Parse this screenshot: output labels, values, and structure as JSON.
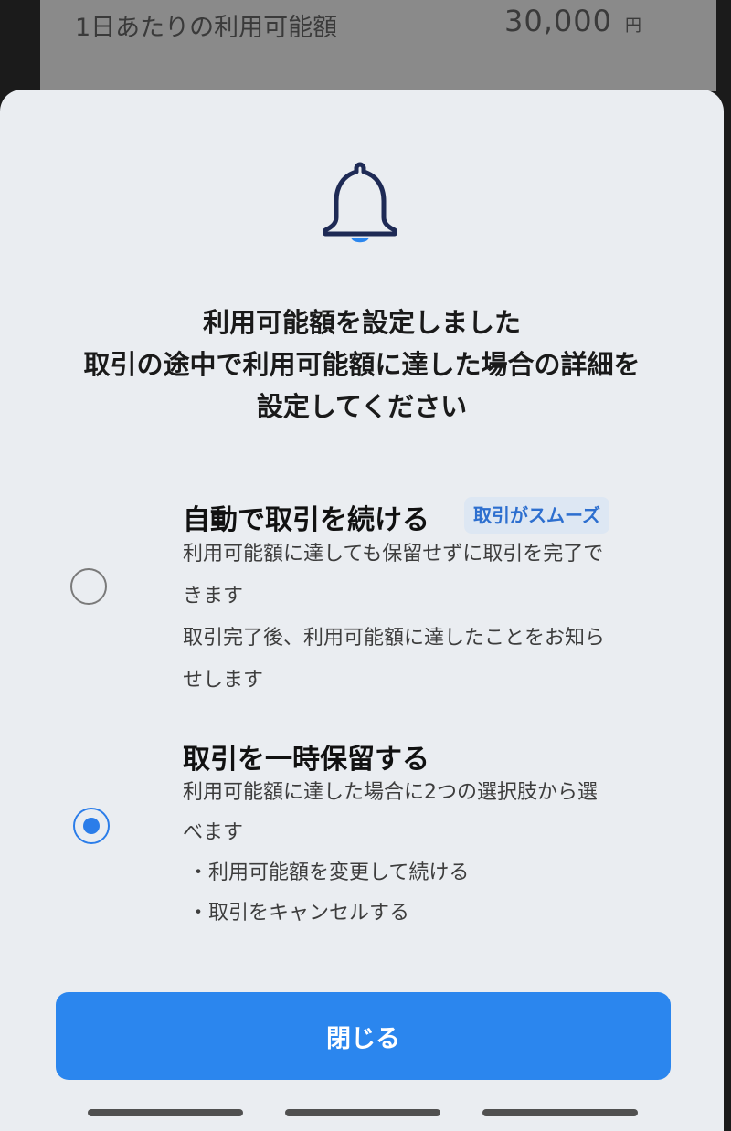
{
  "background": {
    "label": "1日あたりの利用可能額",
    "amount": "30,000",
    "unit": "円"
  },
  "sheet": {
    "icon": "bell-icon",
    "heading_lines": [
      "利用可能額を設定しました",
      "取引の途中で利用可能額に達した場合の詳細を",
      "設定してください"
    ],
    "options": [
      {
        "title": "自動で取引を続ける",
        "badge": "取引がスムーズ",
        "selected": false,
        "description_lines": [
          "利用可能額に達しても保留せずに取引を完了で",
          "きます",
          "取引完了後、利用可能額に達したことをお知ら",
          "せします"
        ]
      },
      {
        "title": "取引を一時保留する",
        "selected": true,
        "description_lines": [
          "利用可能額に達した場合に2つの選択肢から選",
          "べます"
        ],
        "bullets": [
          "・利用可能額を変更して続ける",
          "・取引をキャンセルする"
        ]
      }
    ],
    "close_label": "閉じる"
  },
  "colors": {
    "accent": "#2b86ee",
    "badge_text": "#2d6fcf",
    "sheet_bg": "#eaedf1"
  }
}
